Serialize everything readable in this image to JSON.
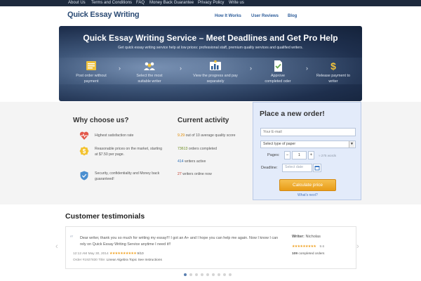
{
  "topbar": {
    "links": [
      "About Us",
      "Terms and Conditions",
      "FAQ",
      "Money Back Guarantee",
      "Privacy Policy",
      "Write us"
    ]
  },
  "header": {
    "logo": "Quick Essay Writing",
    "nav": [
      "How It Works",
      "User Reviews",
      "Blog"
    ]
  },
  "hero": {
    "title": "Quick Essay Writing Service – Meet Deadlines and Get Pro Help",
    "subtitle": "Get quick essay writing service help at low prices: professional staff, premium quality services and qualified writers.",
    "steps": [
      {
        "icon": "order-form-icon",
        "line1": "Post order without",
        "line2": "payment"
      },
      {
        "icon": "writers-group-icon",
        "line1": "Select the most",
        "line2": "suitable writer"
      },
      {
        "icon": "progress-chart-icon",
        "line1": "View the progress and pay",
        "line2": "separately"
      },
      {
        "icon": "approved-document-icon",
        "line1": "Approve",
        "line2": "completed oder"
      },
      {
        "icon": "dollar-icon",
        "line1": "Release payment to",
        "line2": "writer"
      }
    ]
  },
  "why": {
    "title": "Why choose us?",
    "items": [
      {
        "icon": "heart-pulse-icon",
        "text": "Highest satisfaction rate"
      },
      {
        "icon": "price-badge-icon",
        "text": "Reasonable prices on the market, starting at $7.50 per page."
      },
      {
        "icon": "shield-icon",
        "text": "Security, confidentiality and Money back guaranteed!"
      }
    ]
  },
  "activity": {
    "title": "Current activity",
    "rows": [
      {
        "num": "9.29",
        "text": "out of 10 average quality score",
        "color": "#e08a00"
      },
      {
        "num": "73613",
        "text": "orders completed",
        "color": "#6a8a1f"
      },
      {
        "num": "414",
        "text": "writers active",
        "color": "#2f6fb5"
      },
      {
        "num": "27",
        "text": "writers online now",
        "color": "#c0392b"
      }
    ]
  },
  "order": {
    "title": "Place a new order!",
    "email_placeholder": "Your E-mail",
    "paper_placeholder": "Select type of paper",
    "pages_label": "Pages:",
    "pages_value": "1",
    "words": "≈ 275 words",
    "deadline_label": "Deadline:",
    "deadline_placeholder": "Select date",
    "button": "Calculate price",
    "whats_next": "What's next?"
  },
  "testimonials": {
    "title": "Customer testimonials",
    "quote": "Dear writer, thank you so much for writing my essay!!! I got an A+ and I hope you can help me again. Now I know I can rely on Quick Essay Writing Service anytime I need it!!",
    "date": "12:12 AM May 30, 2014",
    "rating": "9/10",
    "order_prefix": "Order",
    "order_no": "#1927830",
    "title_prefix": "Title:",
    "paper_title": "Linear Algebra Topic See Instructions",
    "writer_label": "Writer:",
    "writer_name": "Nicholas",
    "writer_score": "9.6",
    "completed_count": "109",
    "completed_text": "completed orders"
  }
}
